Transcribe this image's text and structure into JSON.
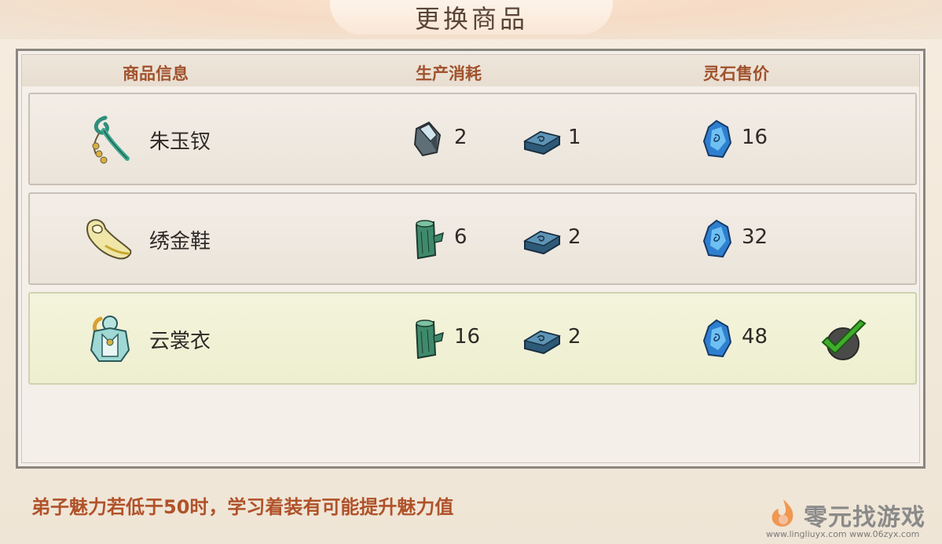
{
  "dialog": {
    "title": "更换商品"
  },
  "table": {
    "headers": {
      "info": "商品信息",
      "cost": "生产消耗",
      "price": "灵石售价"
    },
    "rows": [
      {
        "icon": "jade-hairpin-icon",
        "name": "朱玉钗",
        "cost_a_icon": "crystal-ore-icon",
        "cost_a": "2",
        "cost_b_icon": "iron-ingot-icon",
        "cost_b": "1",
        "price_icon": "spirit-stone-icon",
        "price": "16",
        "selected": false
      },
      {
        "icon": "embroidered-shoe-icon",
        "name": "绣金鞋",
        "cost_a_icon": "wood-log-icon",
        "cost_a": "6",
        "cost_b_icon": "iron-ingot-icon",
        "cost_b": "2",
        "price_icon": "spirit-stone-icon",
        "price": "32",
        "selected": false
      },
      {
        "icon": "cloud-robe-icon",
        "name": "云裳衣",
        "cost_a_icon": "wood-log-icon",
        "cost_a": "16",
        "cost_b_icon": "iron-ingot-icon",
        "cost_b": "2",
        "price_icon": "spirit-stone-icon",
        "price": "48",
        "selected": true
      }
    ]
  },
  "footer": {
    "hint": "弟子魅力若低于50时，学习着装有可能提升魅力值"
  },
  "watermark": {
    "text": "零元找游戏",
    "url": "www.lingliuyx.com   www.06zyx.com"
  },
  "colors": {
    "header_text": "#a0522d",
    "hint_text": "#b0522a",
    "selected_row": "#f4f4dc",
    "check_green": "#3fae2a"
  }
}
